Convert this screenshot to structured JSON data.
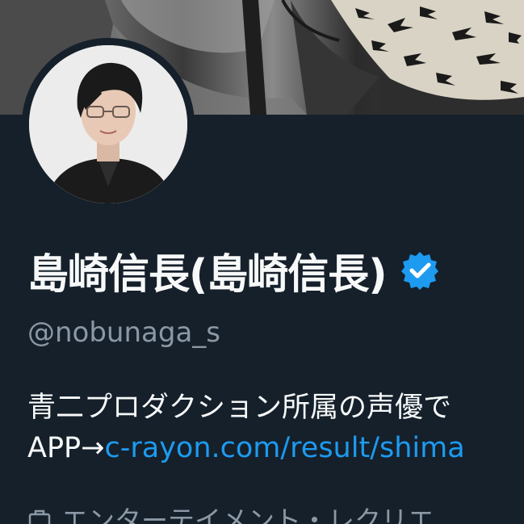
{
  "profile": {
    "display_name": "島崎信長(島崎信長)",
    "handle": "@nobunaga_s",
    "verified_icon": "verified-badge-icon",
    "bio_line1": "青二プロダクション所属の声優で",
    "bio_line2_prefix": "APP→",
    "bio_link": "c-rayon.com/result/shima",
    "category_icon": "briefcase-icon",
    "category": "エンターテイメント・レクリエ"
  },
  "colors": {
    "background": "#15202b",
    "text_primary": "#f7f9f9",
    "text_secondary": "#8b98a5",
    "link": "#1d9bf0",
    "verified": "#1d9bf0"
  }
}
